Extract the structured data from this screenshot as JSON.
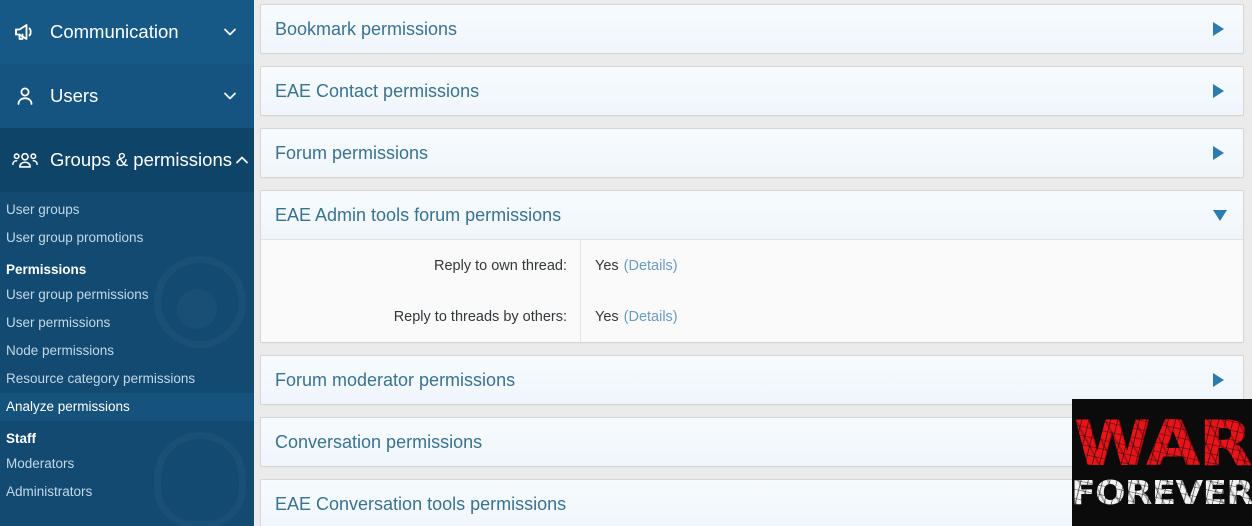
{
  "sidebar": {
    "groups": [
      {
        "icon": "megaphone-icon",
        "label": "Communication",
        "chevron": "chevron-down-icon",
        "expanded": false
      },
      {
        "icon": "user-icon",
        "label": "Users",
        "chevron": "chevron-down-icon",
        "expanded": false
      },
      {
        "icon": "people-group-icon",
        "label": "Groups & permissions",
        "chevron": "chevron-up-icon",
        "expanded": true
      }
    ],
    "links_top": [
      {
        "label": "User groups",
        "active": false
      },
      {
        "label": "User group promotions",
        "active": false
      }
    ],
    "heading_permissions": "Permissions",
    "links_permissions": [
      {
        "label": "User group permissions",
        "active": false
      },
      {
        "label": "User permissions",
        "active": false
      },
      {
        "label": "Node permissions",
        "active": false
      },
      {
        "label": "Resource category permissions",
        "active": false
      },
      {
        "label": "Analyze permissions",
        "active": true
      }
    ],
    "heading_staff": "Staff",
    "links_staff": [
      {
        "label": "Moderators",
        "active": false
      },
      {
        "label": "Administrators",
        "active": false
      }
    ],
    "accent_color": "#4fa3e3",
    "background_color": "#124a71"
  },
  "main": {
    "panels": [
      {
        "title": "Bookmark permissions",
        "expanded": false,
        "toggle_icon": "triangle-right-icon",
        "rows": []
      },
      {
        "title": "EAE Contact permissions",
        "expanded": false,
        "toggle_icon": "triangle-right-icon",
        "rows": []
      },
      {
        "title": "Forum permissions",
        "expanded": false,
        "toggle_icon": "triangle-right-icon",
        "rows": []
      },
      {
        "title": "EAE Admin tools forum permissions",
        "expanded": true,
        "toggle_icon": "triangle-down-icon",
        "rows": [
          {
            "label": "Reply to own thread:",
            "value": "Yes",
            "details_label": "(Details)"
          },
          {
            "label": "Reply to threads by others:",
            "value": "Yes",
            "details_label": "(Details)"
          }
        ]
      },
      {
        "title": "Forum moderator permissions",
        "expanded": false,
        "toggle_icon": "triangle-right-icon",
        "rows": []
      },
      {
        "title": "Conversation permissions",
        "expanded": false,
        "toggle_icon": "triangle-right-icon",
        "rows": []
      },
      {
        "title": "EAE Conversation tools permissions",
        "expanded": false,
        "toggle_icon": "triangle-right-icon",
        "rows": []
      }
    ],
    "link_color": "#6a9cc4",
    "title_color": "#3b728f"
  },
  "overlay": {
    "line1": "WAR",
    "line2": "FOREVER",
    "line1_color": "#e8141a",
    "line2_color": "#f2f2f2",
    "background_color": "#0b0b0b"
  }
}
